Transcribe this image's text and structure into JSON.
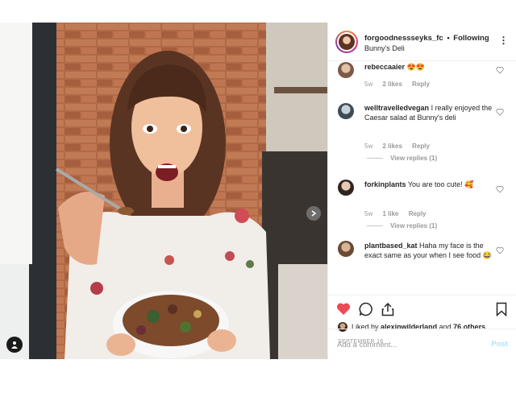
{
  "header": {
    "username": "forgoodnessseyks_fc",
    "separator": "•",
    "follow_status": "Following",
    "location": "Bunny's Deli",
    "more_icon": "more-horizontal-icon"
  },
  "comments": [
    {
      "user": "rebeccaaier",
      "text": "😍😍",
      "age": "5w",
      "likes": "2 likes",
      "reply": "Reply",
      "view_replies": ""
    },
    {
      "user": "welltravelledvegan",
      "text": "I really enjoyed the Caesar salad at Bunny's deli",
      "age": "5w",
      "likes": "2 likes",
      "reply": "Reply",
      "view_replies": "View replies (1)"
    },
    {
      "user": "forkinplants",
      "text": "You are too cute! 🥰",
      "age": "5w",
      "likes": "1 like",
      "reply": "Reply",
      "view_replies": "View replies (1)"
    },
    {
      "user": "plantbased_kat",
      "text": "Haha my face is the exact same as your when I see food 😂",
      "age": "",
      "likes": "",
      "reply": "",
      "view_replies": ""
    }
  ],
  "actions": {
    "liked_by_prefix": "Liked by",
    "liked_by_user": "alexinwilderland",
    "and_text": "and",
    "others": "76 others",
    "date": "SEPTEMBER 16"
  },
  "comment_box": {
    "placeholder": "Add a comment...",
    "post_label": "Post"
  },
  "colors": {
    "like_red": "#ed4956",
    "post_disabled": "#b2dffc",
    "muted": "#999999"
  }
}
